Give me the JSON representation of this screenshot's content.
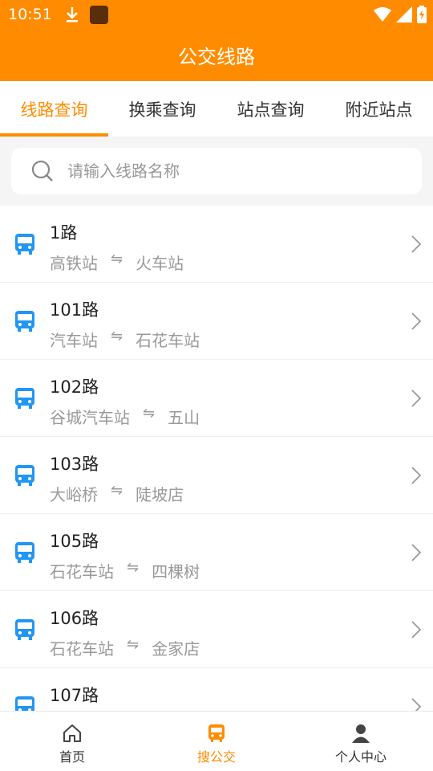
{
  "status_bar": {
    "time": "10:51"
  },
  "header": {
    "title": "公交线路"
  },
  "tabs": [
    {
      "label": "线路查询",
      "active": true
    },
    {
      "label": "换乘查询",
      "active": false
    },
    {
      "label": "站点查询",
      "active": false
    },
    {
      "label": "附近站点",
      "active": false
    }
  ],
  "search": {
    "placeholder": "请输入线路名称",
    "value": ""
  },
  "routes": [
    {
      "name": "1路",
      "from": "高铁站",
      "to": "火车站"
    },
    {
      "name": "101路",
      "from": "汽车站",
      "to": "石花车站"
    },
    {
      "name": "102路",
      "from": "谷城汽车站",
      "to": "五山"
    },
    {
      "name": "103路",
      "from": "大峪桥",
      "to": "陡坡店"
    },
    {
      "name": "105路",
      "from": "石花车站",
      "to": "四棵树"
    },
    {
      "name": "106路",
      "from": "石花车站",
      "to": "金家店"
    },
    {
      "name": "107路",
      "from": "",
      "to": ""
    }
  ],
  "route_arrow": "⇋",
  "bottom_nav": [
    {
      "label": "首页",
      "icon": "home-icon",
      "active": false
    },
    {
      "label": "搜公交",
      "icon": "bus-icon",
      "active": true
    },
    {
      "label": "个人中心",
      "icon": "user-icon",
      "active": false
    }
  ],
  "colors": {
    "accent": "#ff8c00",
    "bus_icon": "#2196f3"
  }
}
